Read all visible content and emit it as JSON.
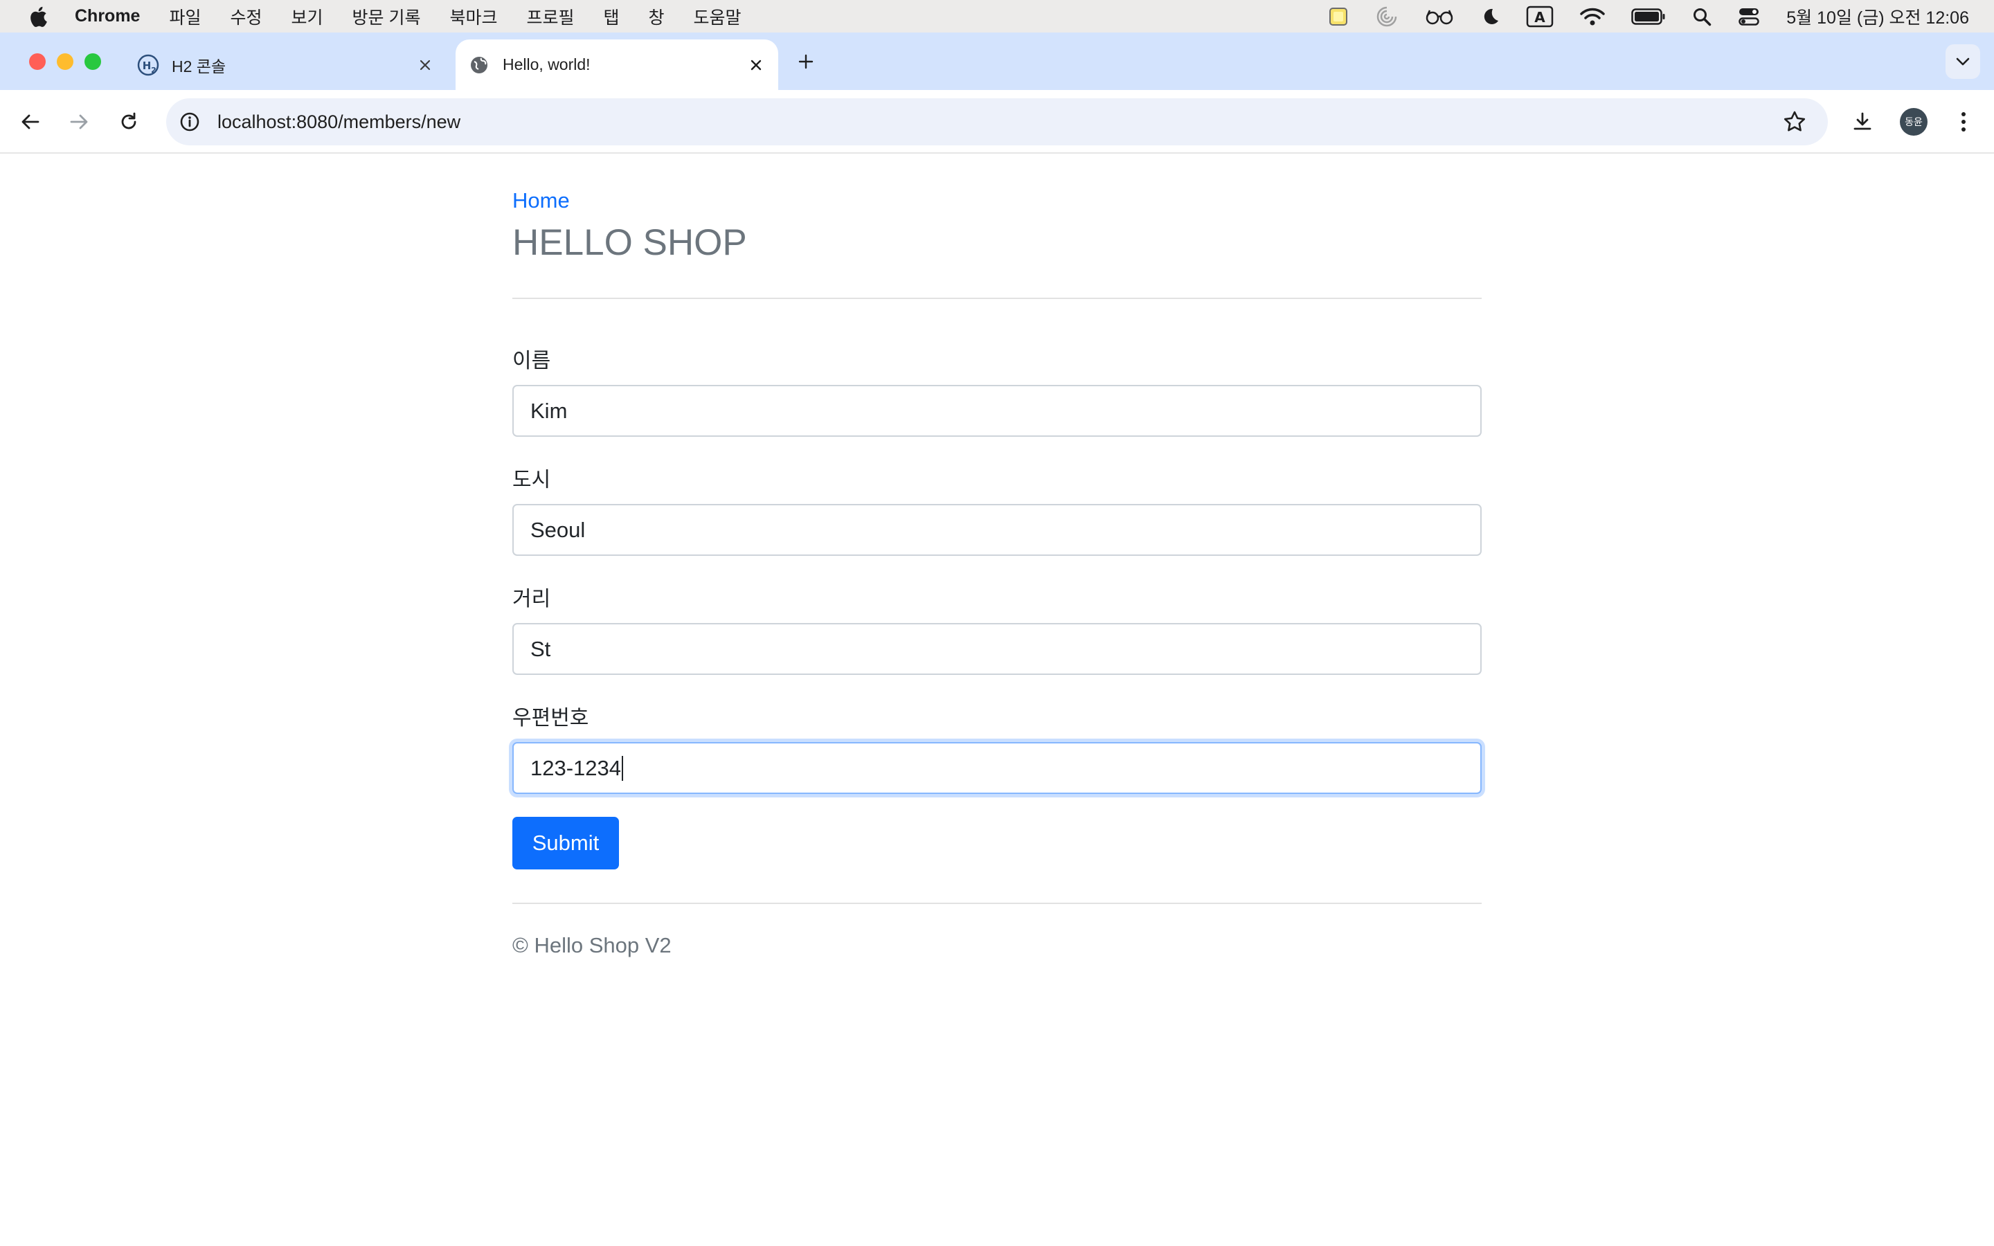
{
  "menubar": {
    "app_name": "Chrome",
    "items": [
      "파일",
      "수정",
      "보기",
      "방문 기록",
      "북마크",
      "프로필",
      "탭",
      "창",
      "도움말"
    ],
    "clock": "5월 10일 (금) 오전 12:06"
  },
  "tabs": [
    {
      "title": "H2 콘솔",
      "favicon": "h2-logo-icon",
      "active": false
    },
    {
      "title": "Hello, world!",
      "favicon": "globe-icon",
      "active": true
    }
  ],
  "toolbar": {
    "url": "localhost:8080/members/new",
    "avatar_label": "동윤"
  },
  "page": {
    "home_link": "Home",
    "title": "HELLO SHOP",
    "form": {
      "fields": [
        {
          "label": "이름",
          "value": "Kim"
        },
        {
          "label": "도시",
          "value": "Seoul"
        },
        {
          "label": "거리",
          "value": "St"
        },
        {
          "label": "우편번호",
          "value": "123-1234"
        }
      ],
      "submit_label": "Submit"
    },
    "footer": "© Hello Shop V2"
  },
  "colors": {
    "accent": "#0d6efd",
    "muted_text": "#6c757d",
    "tabstrip": "#d3e3fd"
  }
}
